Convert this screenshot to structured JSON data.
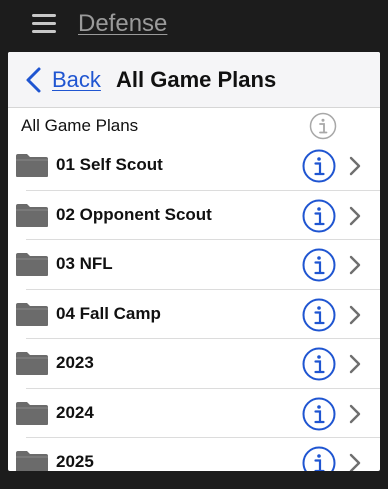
{
  "app": {
    "title": "Defense"
  },
  "nav": {
    "back_label": "Back",
    "title": "All Game Plans"
  },
  "section": {
    "title": "All Game Plans"
  },
  "items": [
    {
      "label": "01 Self Scout"
    },
    {
      "label": "02 Opponent Scout"
    },
    {
      "label": "03 NFL"
    },
    {
      "label": "04 Fall Camp"
    },
    {
      "label": "2023"
    },
    {
      "label": "2024"
    },
    {
      "label": "2025"
    }
  ],
  "icons": {
    "menu": "hamburger-icon",
    "back": "chevron-left-icon",
    "folder": "folder-icon",
    "info": "info-icon",
    "disclosure": "chevron-right-icon"
  },
  "colors": {
    "accent": "#1f55d1",
    "folder": "#6b6b6b",
    "chrome": "#1c1c1c",
    "info_disabled": "#a8a8a8"
  }
}
